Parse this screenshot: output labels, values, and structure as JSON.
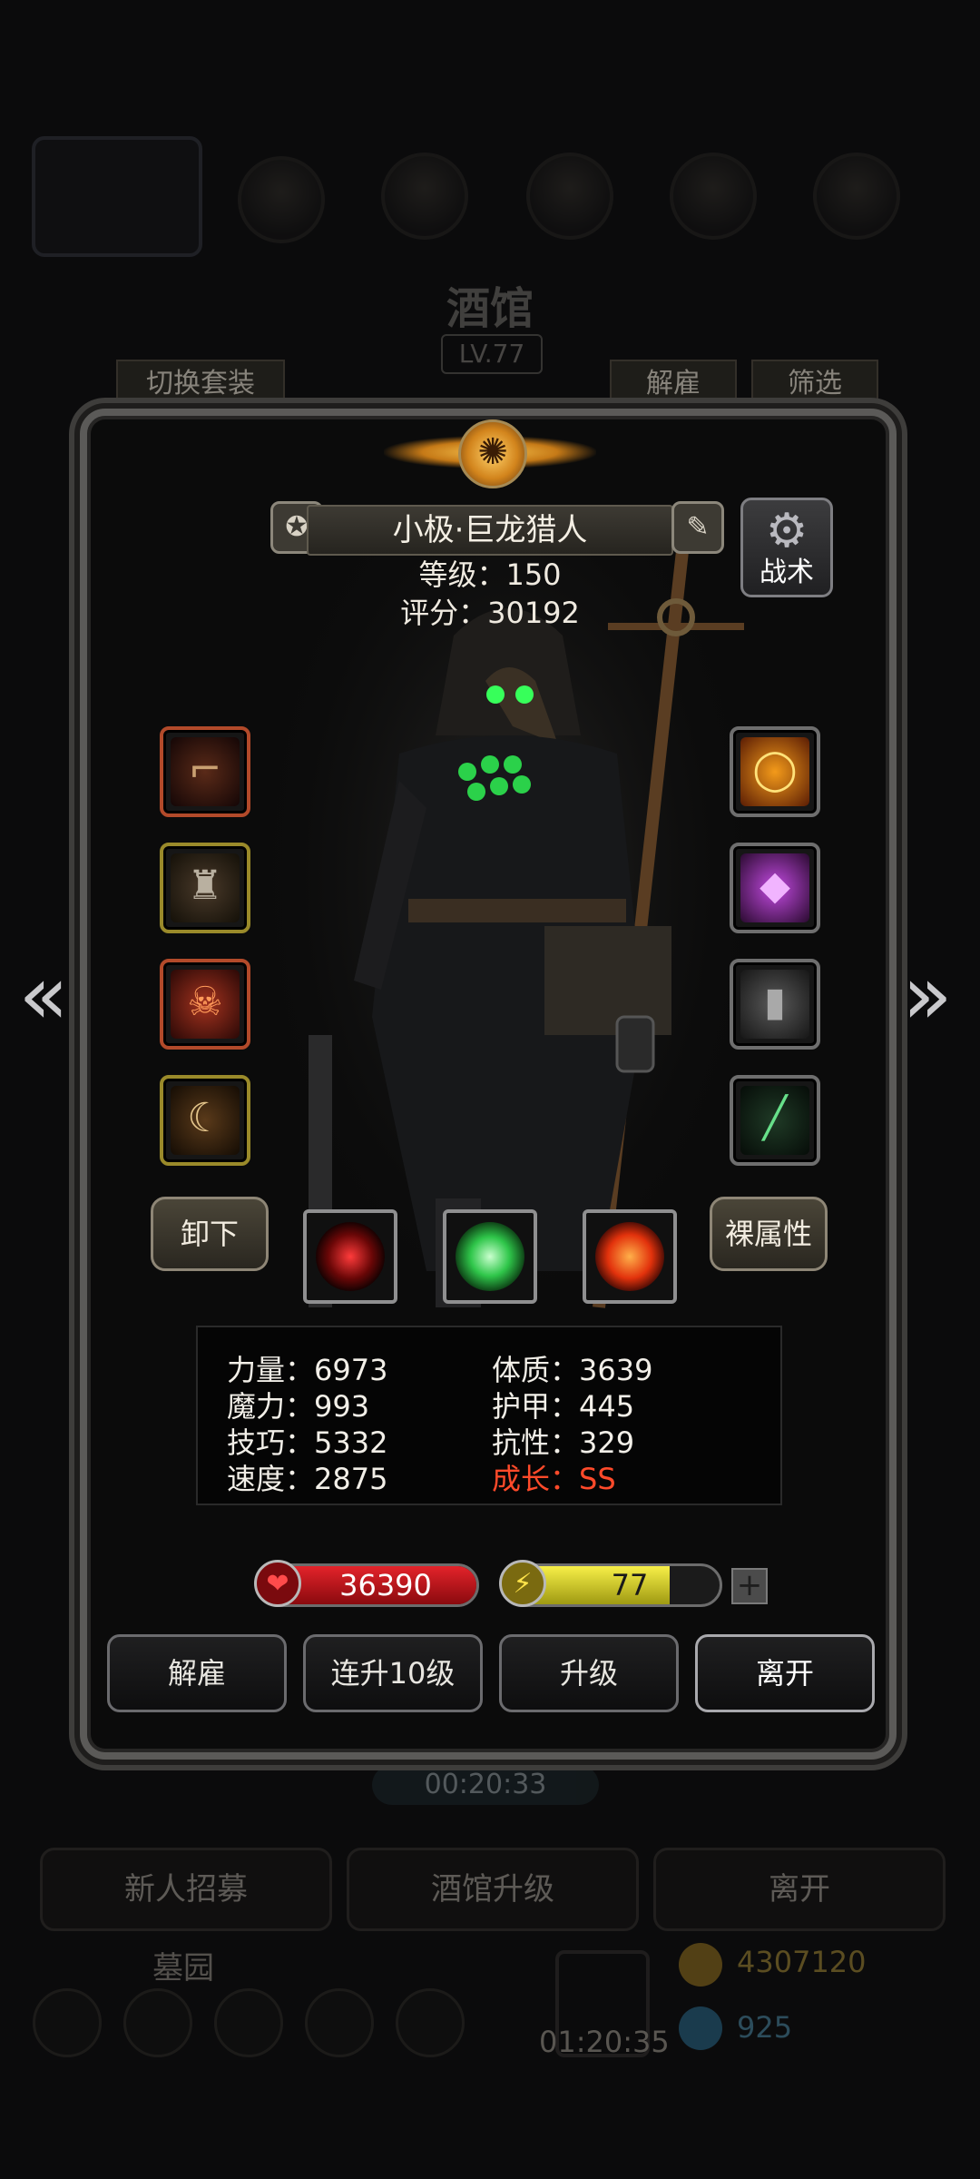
{
  "background": {
    "title": "酒馆",
    "level": "LV.77",
    "switch_outfit": "切换套装",
    "dismiss": "解雇",
    "filter": "筛选",
    "timer": "00:20:33",
    "bottom_buttons": [
      "新人招募",
      "酒馆升级",
      "离开"
    ],
    "graveyard": "墓园",
    "gift_timer": "01:20:35",
    "gold": "4307120",
    "gems": "925"
  },
  "hero": {
    "name": "小极·巨龙猎人",
    "level_text": "等级：150",
    "score_text": "评分：30192",
    "tactics_label": "战术"
  },
  "equipment": {
    "left": [
      "pistol",
      "chest-armor",
      "demon-helm",
      "horn-charm"
    ],
    "right": [
      "fire-ring",
      "crystal",
      "tombstone",
      "serpent-staff"
    ]
  },
  "actions": {
    "unequip": "卸下",
    "base_attrs": "裸属性"
  },
  "skills": [
    "red-target-skill",
    "green-ghost-skill",
    "red-cross-skill"
  ],
  "attributes": {
    "strength": "力量：6973",
    "magic": "魔力：993",
    "skill": "技巧：5332",
    "speed": "速度：2875",
    "constitution": "体质：3639",
    "armor": "护甲：445",
    "resistance": "抗性：329",
    "growth": "成长：SS"
  },
  "bars": {
    "hp": "36390",
    "hp_fill": 1.0,
    "energy": "77",
    "energy_fill": 0.77
  },
  "buttons": {
    "dismiss": "解雇",
    "level10": "连升10级",
    "upgrade": "升级",
    "leave": "离开"
  },
  "colors": {
    "hp": "#e3232a",
    "energy": "#f7ef48",
    "growth": "#ff4a2a",
    "emblem": "#f6c24d"
  }
}
